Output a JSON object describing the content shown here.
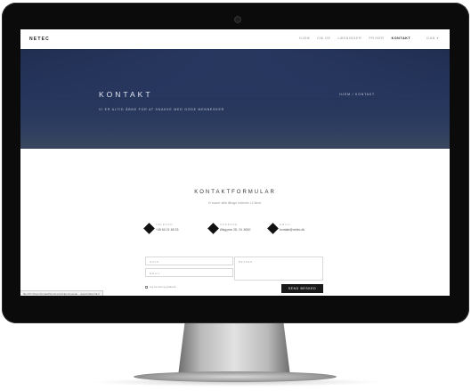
{
  "site": {
    "logo": "NETEC",
    "nav": [
      {
        "label": "HJEM",
        "active": false
      },
      {
        "label": "OM OS",
        "active": false
      },
      {
        "label": "LØSNINGER",
        "active": false
      },
      {
        "label": "PRISER",
        "active": false
      },
      {
        "label": "KONTAKT",
        "active": true
      }
    ],
    "language": "DAN ▾"
  },
  "hero": {
    "title": "KONTAKT",
    "subtitle": "VI ER ALTID ÅBNE FOR AT SNAKKE MED GODE MENNESKER",
    "breadcrumb": "HJEM / KONTAKT"
  },
  "contact": {
    "title": "KONTAKTFORMULAR",
    "subtitle": "Vi svarer altid tilbage indenfor 12 timer.",
    "info": [
      {
        "label": "TELEFON",
        "value": "+45 60 21 68 33",
        "icon": "phone-icon"
      },
      {
        "label": "ADRESSE",
        "value": "Ølsgyrne 2D, St. 8000",
        "icon": "location-icon"
      },
      {
        "label": "EMAIL",
        "value": "kontakt@netec.dk",
        "icon": "mail-icon"
      }
    ],
    "form": {
      "name_placeholder": "NAVN",
      "email_placeholder": "EMAIL",
      "message_placeholder": "BESKED",
      "terms_text": "Jeg har læst og godkendt",
      "submit_label": "SEND BESKED"
    }
  },
  "browser": {
    "status_text": "file:///C:/Users/Jonas/Documents/Hjemmeside - netec/index.html"
  }
}
